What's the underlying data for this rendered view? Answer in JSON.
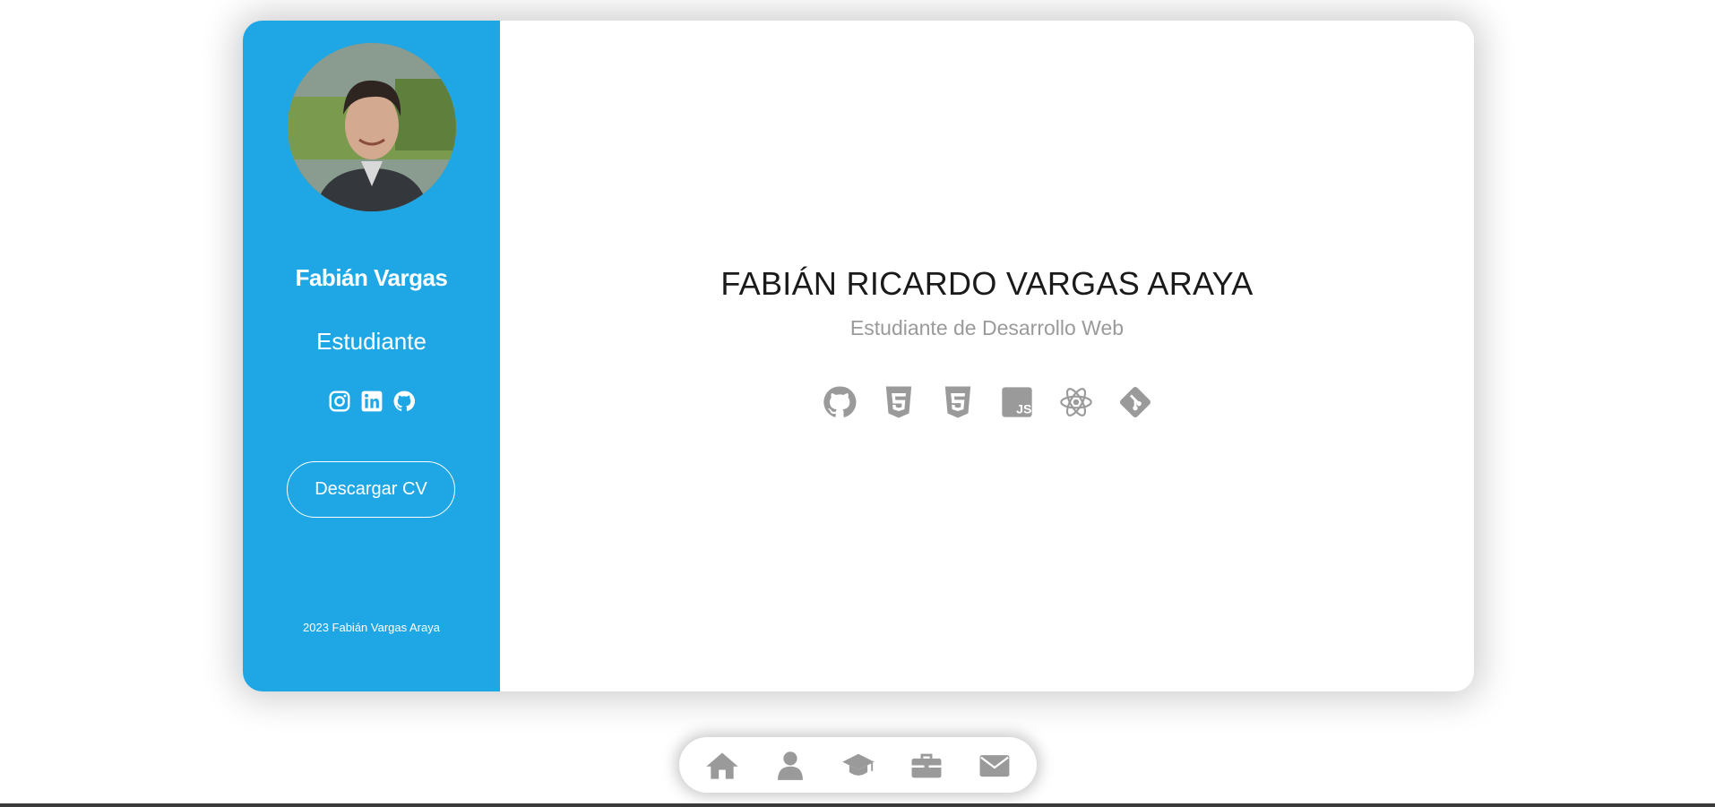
{
  "profile": {
    "name": "Fabián Vargas",
    "role": "Estudiante",
    "download_label": "Descargar CV",
    "copyright": "2023 Fabián Vargas Araya",
    "social": [
      "instagram-icon",
      "linkedin-icon",
      "github-icon"
    ]
  },
  "main": {
    "full_name": "FABIÁN RICARDO VARGAS ARAYA",
    "subtitle": "Estudiante de Desarrollo Web",
    "tech_icons": [
      "github-icon",
      "html5-icon",
      "css3-icon",
      "javascript-icon",
      "react-icon",
      "git-icon"
    ]
  },
  "nav": {
    "items": [
      "home-icon",
      "user-icon",
      "graduation-cap-icon",
      "briefcase-icon",
      "envelope-icon"
    ]
  },
  "colors": {
    "sidebar": "#1fa7e5",
    "icon_gray": "#9a9a9a",
    "headline": "#1a1a1a"
  }
}
